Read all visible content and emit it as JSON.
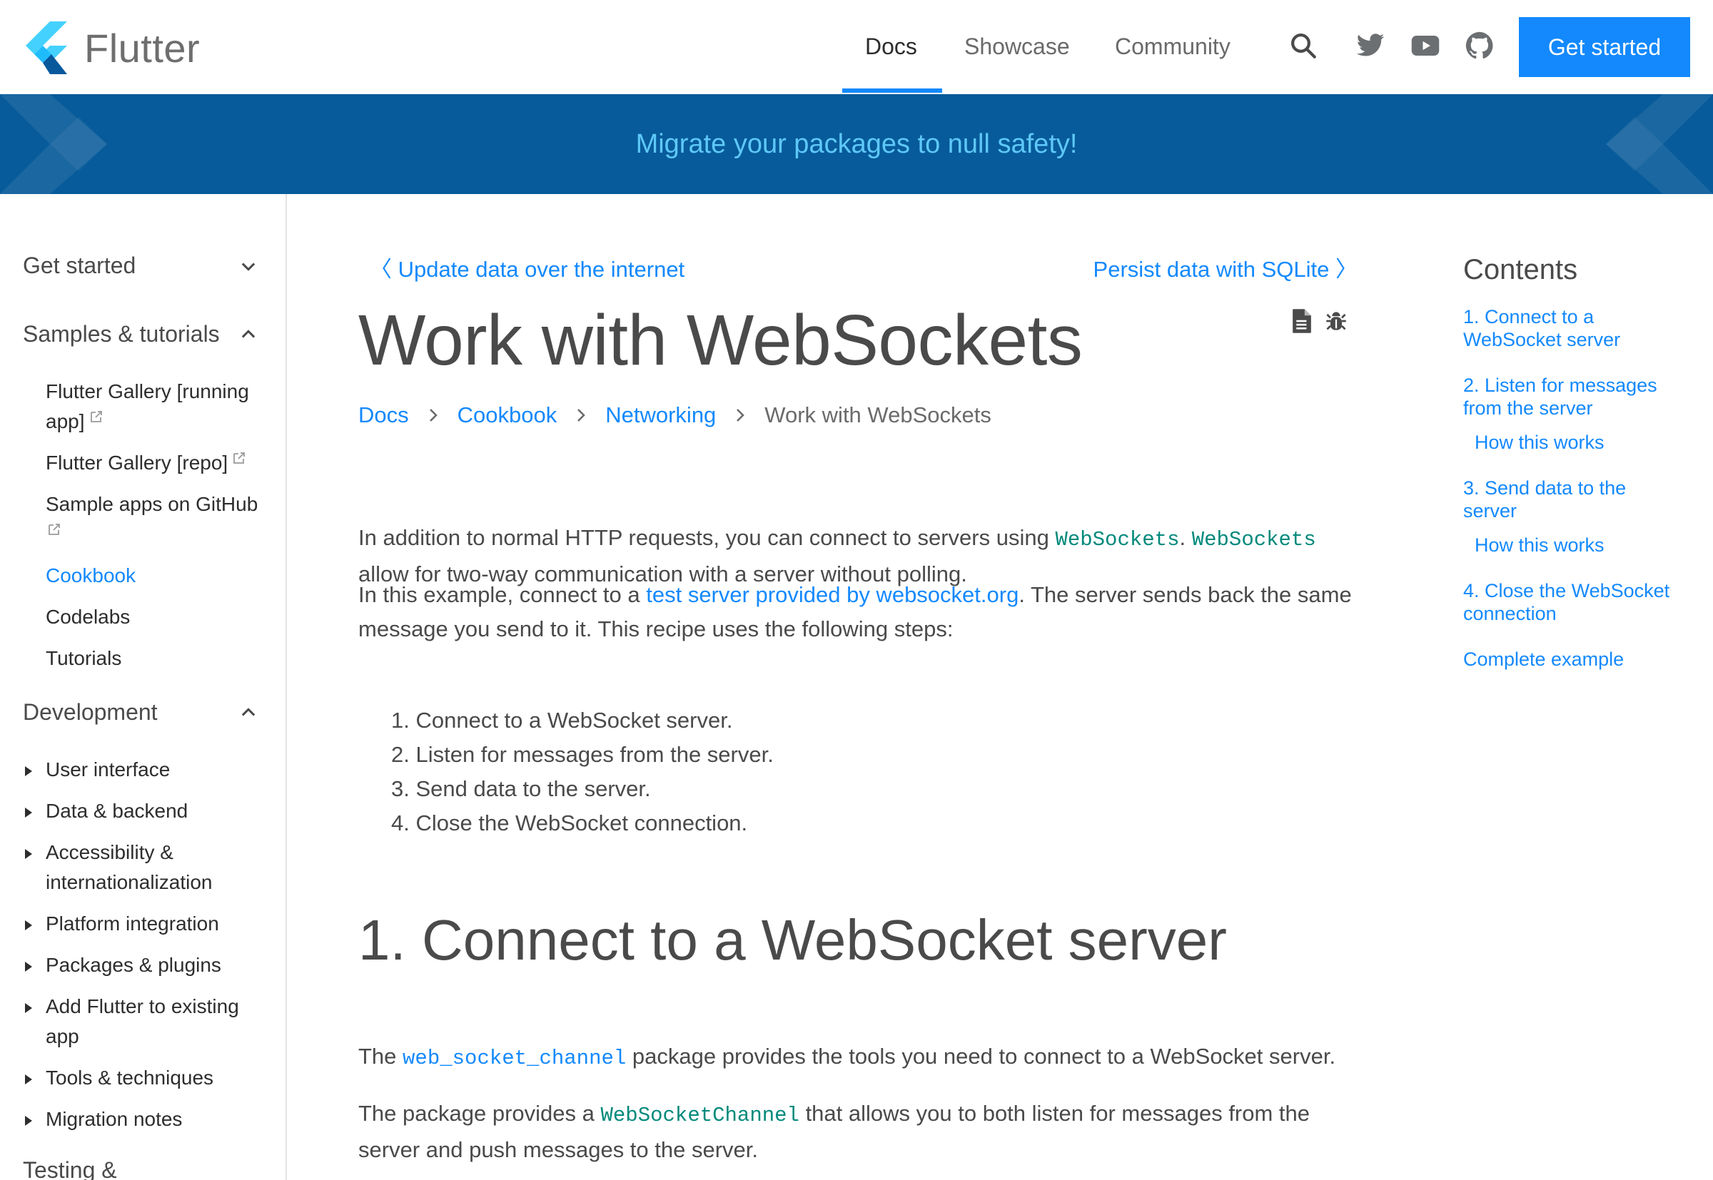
{
  "header": {
    "logo_text": "Flutter",
    "nav": [
      {
        "label": "Docs",
        "active": true
      },
      {
        "label": "Showcase",
        "active": false
      },
      {
        "label": "Community",
        "active": false
      }
    ],
    "icons": [
      "search-icon",
      "twitter-icon",
      "youtube-icon",
      "github-icon"
    ],
    "cta_label": "Get started"
  },
  "banner": {
    "text": "Migrate your packages to null safety!"
  },
  "sidebar": {
    "sections": [
      {
        "label": "Get started",
        "expanded": false
      },
      {
        "label": "Samples & tutorials",
        "expanded": true
      },
      {
        "label": "Development",
        "expanded": true
      },
      {
        "label": "Testing &",
        "expanded": false
      }
    ],
    "samples_items": [
      {
        "label": "Flutter Gallery [running app]",
        "external": true,
        "active": false
      },
      {
        "label": "Flutter Gallery [repo]",
        "external": true,
        "active": false
      },
      {
        "label": "Sample apps on GitHub",
        "external": true,
        "active": false
      },
      {
        "label": "Cookbook",
        "external": false,
        "active": true
      },
      {
        "label": "Codelabs",
        "external": false,
        "active": false
      },
      {
        "label": "Tutorials",
        "external": false,
        "active": false
      }
    ],
    "development_items": [
      {
        "label": "User interface"
      },
      {
        "label": "Data & backend"
      },
      {
        "label": "Accessibility & internationalization"
      },
      {
        "label": "Platform integration"
      },
      {
        "label": "Packages & plugins"
      },
      {
        "label": "Add Flutter to existing app"
      },
      {
        "label": "Tools & techniques"
      },
      {
        "label": "Migration notes"
      }
    ]
  },
  "main": {
    "prev_link": "Update data over the internet",
    "next_link": "Persist data with SQLite",
    "title": "Work with WebSockets",
    "title_icons": [
      "view-source-icon",
      "report-bug-icon"
    ],
    "breadcrumb": [
      {
        "label": "Docs",
        "link": true
      },
      {
        "label": "Cookbook",
        "link": true
      },
      {
        "label": "Networking",
        "link": true
      },
      {
        "label": "Work with WebSockets",
        "link": false
      }
    ],
    "intro": {
      "p1_a": "In addition to normal HTTP requests, you can connect to servers using ",
      "p1_code1": "WebSockets",
      "p1_b": ". ",
      "p1_code2": "WebSockets",
      "p1_c": " allow for two-way communication with a server without polling.",
      "p2_a": "In this example, connect to a ",
      "p2_link": "test server provided by websocket.org",
      "p2_b": ". The server sends back the same message you send to it. This recipe uses the following steps:"
    },
    "steps": [
      "1. Connect to a WebSocket server.",
      "2. Listen for messages from the server.",
      "3. Send data to the server.",
      "4. Close the WebSocket connection."
    ],
    "section1": {
      "heading": "1. Connect to a WebSocket server",
      "p1_a": "The ",
      "p1_code": "web_socket_channel",
      "p1_b": " package provides the tools you need to connect to a WebSocket server.",
      "p2_a": "The package provides a ",
      "p2_code": "WebSocketChannel",
      "p2_b": " that allows you to both listen for messages from the server and push messages to the server."
    }
  },
  "toc": {
    "title": "Contents",
    "items": [
      {
        "label": "1. Connect to a WebSocket server",
        "sub": false
      },
      {
        "label": "2. Listen for messages from the server",
        "sub": false
      },
      {
        "label": "How this works",
        "sub": true
      },
      {
        "label": "3. Send data to the server",
        "sub": false
      },
      {
        "label": "How this works",
        "sub": true
      },
      {
        "label": "4. Close the WebSocket connection",
        "sub": false
      },
      {
        "label": "Complete example",
        "sub": false
      }
    ]
  },
  "colors": {
    "brand_blue": "#1389fd",
    "banner_bg": "#075b9a",
    "banner_text": "#5ec8f8",
    "code_green": "#00897b",
    "text": "#4a4a4a"
  }
}
